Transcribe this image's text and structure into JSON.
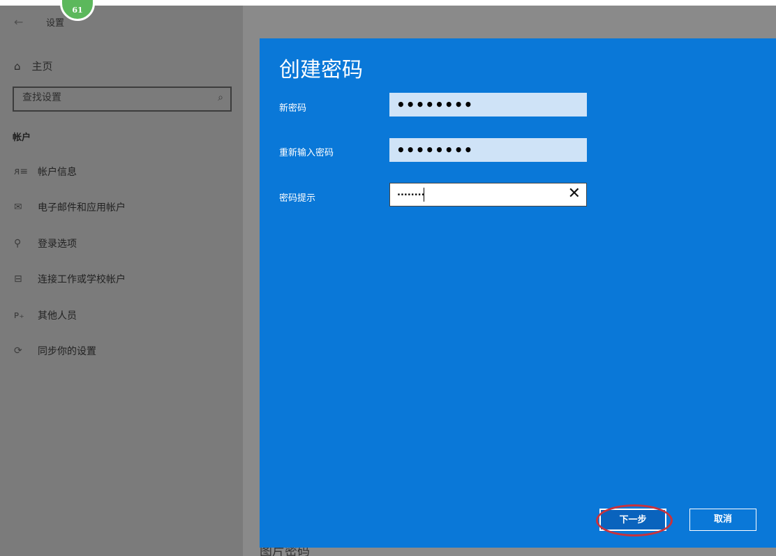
{
  "window": {
    "back_glyph": "←",
    "title": "设置",
    "badge": "61"
  },
  "sidebar": {
    "home": {
      "icon": "home-icon",
      "glyph": "⌂",
      "label": "主页"
    },
    "search": {
      "placeholder": "查找设置",
      "icon": "search-icon",
      "glyph": "⌕"
    },
    "section_title": "帐户",
    "items": [
      {
        "icon": "person-card-icon",
        "glyph": "ᴙ≡",
        "label": "帐户信息"
      },
      {
        "icon": "mail-icon",
        "glyph": "✉",
        "label": "电子邮件和应用帐户"
      },
      {
        "icon": "key-icon",
        "glyph": "⚲",
        "label": "登录选项"
      },
      {
        "icon": "briefcase-icon",
        "glyph": "⊟",
        "label": "连接工作或学校帐户"
      },
      {
        "icon": "add-person-icon",
        "glyph": "ᴘ₊",
        "label": "其他人员"
      },
      {
        "icon": "sync-icon",
        "glyph": "⟳",
        "label": "同步你的设置"
      }
    ]
  },
  "dialog": {
    "title": "创建密码",
    "fields": {
      "new_password": {
        "label": "新密码",
        "value": "••••••••"
      },
      "confirm_password": {
        "label": "重新输入密码",
        "value": "••••••••"
      },
      "hint": {
        "label": "密码提示",
        "value": "........"
      }
    },
    "clear_glyph": "✕",
    "next_label": "下一步",
    "cancel_label": "取消"
  },
  "background_fragment": "图片密码",
  "colors": {
    "dialog_bg": "#0a78d8",
    "overlay_dim": "#7b7b7b",
    "highlight": "#c8323c"
  }
}
